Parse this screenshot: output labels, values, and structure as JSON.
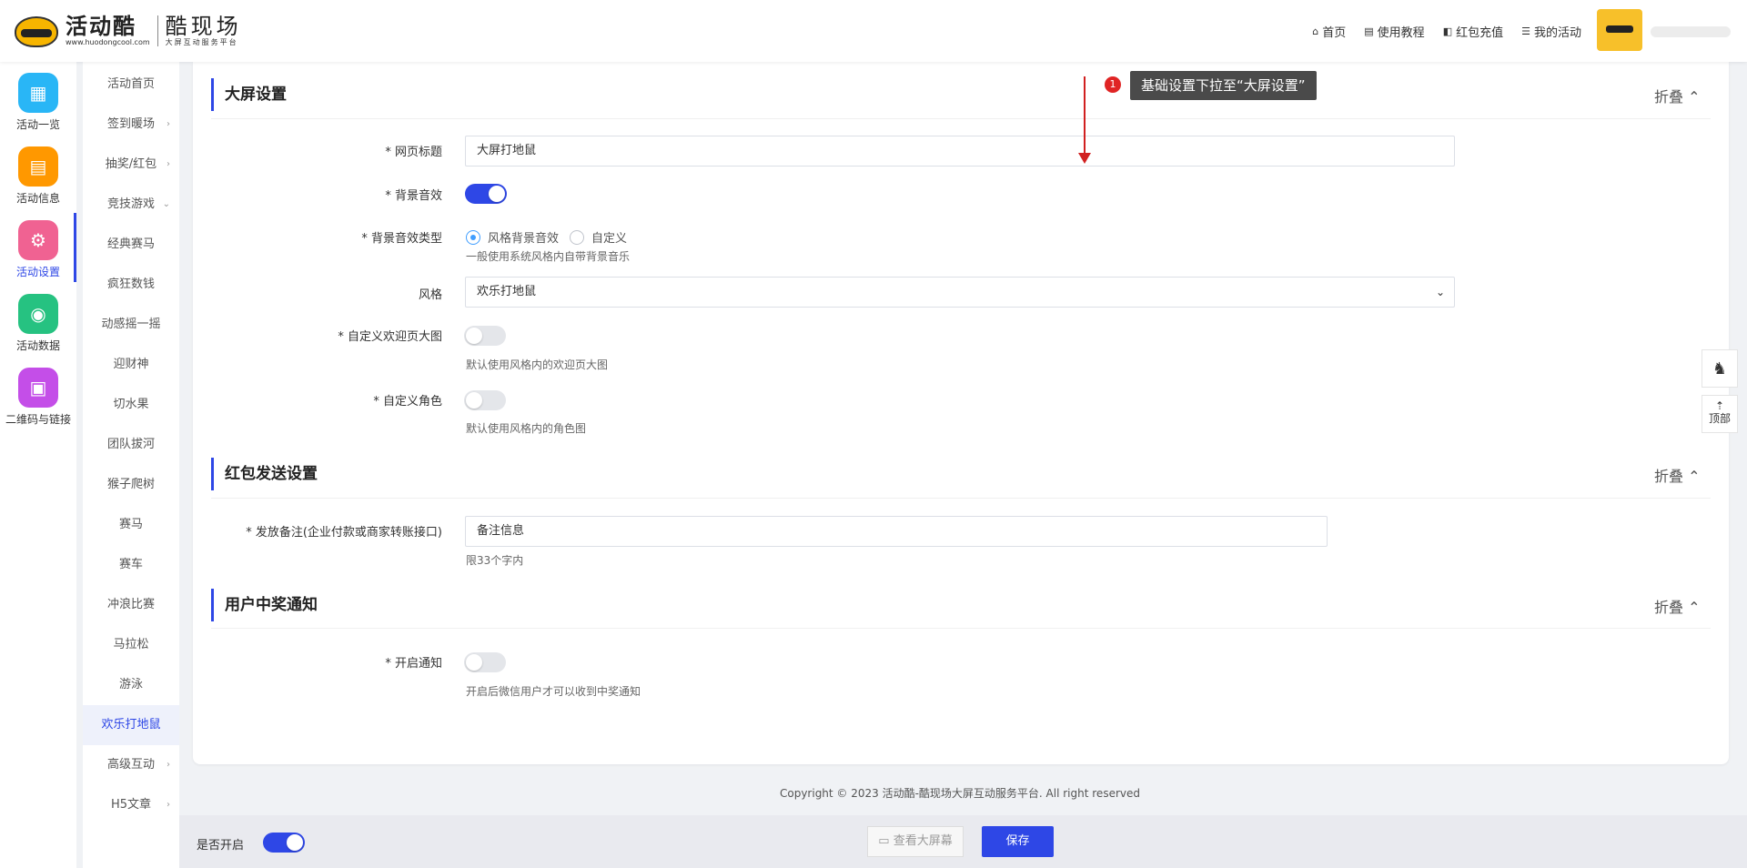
{
  "header": {
    "logo_main": "活动酷",
    "logo_url": "www.huodongcool.com",
    "logo_sub_main": "酷现场",
    "logo_sub_small": "大屏互动服务平台",
    "nav": [
      {
        "icon": "home-icon",
        "glyph": "⌂",
        "label": "首页"
      },
      {
        "icon": "document-icon",
        "glyph": "▤",
        "label": "使用教程"
      },
      {
        "icon": "redpacket-icon",
        "glyph": "◧",
        "label": "红包充值"
      },
      {
        "icon": "list-icon",
        "glyph": "☰",
        "label": "我的活动"
      }
    ]
  },
  "icon_sidebar": [
    {
      "label": "活动一览",
      "icon": "grid-icon",
      "color": "#29b6f6",
      "glyph": "▦"
    },
    {
      "label": "活动信息",
      "icon": "file-icon",
      "color": "#ff9800",
      "glyph": "▤"
    },
    {
      "label": "活动设置",
      "icon": "gear-icon",
      "color": "#f06292",
      "glyph": "⚙",
      "active": true
    },
    {
      "label": "活动数据",
      "icon": "database-icon",
      "color": "#26c281",
      "glyph": "◉"
    },
    {
      "label": "二维码与链接",
      "icon": "qrcode-icon",
      "color": "#c44ee8",
      "glyph": "▣"
    }
  ],
  "sub_sidebar": [
    {
      "label": "活动首页",
      "arrow": ""
    },
    {
      "label": "签到暖场",
      "arrow": "›"
    },
    {
      "label": "抽奖/红包",
      "arrow": "›"
    },
    {
      "label": "竞技游戏",
      "arrow": "⌄"
    },
    {
      "label": "经典赛马",
      "arrow": ""
    },
    {
      "label": "疯狂数钱",
      "arrow": ""
    },
    {
      "label": "动感摇一摇",
      "arrow": ""
    },
    {
      "label": "迎财神",
      "arrow": ""
    },
    {
      "label": "切水果",
      "arrow": ""
    },
    {
      "label": "团队拔河",
      "arrow": ""
    },
    {
      "label": "猴子爬树",
      "arrow": ""
    },
    {
      "label": "赛马",
      "arrow": ""
    },
    {
      "label": "赛车",
      "arrow": ""
    },
    {
      "label": "冲浪比赛",
      "arrow": ""
    },
    {
      "label": "马拉松",
      "arrow": ""
    },
    {
      "label": "游泳",
      "arrow": ""
    },
    {
      "label": "欢乐打地鼠",
      "arrow": "",
      "active": true
    },
    {
      "label": "高级互动",
      "arrow": "›"
    },
    {
      "label": "H5文章",
      "arrow": "›"
    }
  ],
  "annotation": {
    "step": "1",
    "text": "基础设置下拉至“大屏设置”"
  },
  "screen_section": {
    "title": "大屏设置",
    "collapse_label": "折叠 ⌃",
    "page_title_label": "* 网页标题",
    "page_title_value": "大屏打地鼠",
    "bg_sound_label": "* 背景音效",
    "bg_sound_on": true,
    "bg_sound_type_label": "* 背景音效类型",
    "bg_sound_type_options": [
      "风格背景音效",
      "自定义"
    ],
    "bg_sound_type_hint": "一般使用系统风格内自带背景音乐",
    "style_label": "风格",
    "style_value": "欢乐打地鼠",
    "custom_welcome_label": "* 自定义欢迎页大图",
    "custom_welcome_on": false,
    "custom_welcome_hint": "默认使用风格内的欢迎页大图",
    "custom_role_label": "* 自定义角色",
    "custom_role_on": false,
    "custom_role_hint": "默认使用风格内的角色图"
  },
  "redpacket_section": {
    "title": "红包发送设置",
    "collapse_label": "折叠 ⌃",
    "remark_label": "* 发放备注(企业付款或商家转账接口)",
    "remark_value": "备注信息",
    "remark_hint": "限33个字内"
  },
  "notify_section": {
    "title": "用户中奖通知",
    "collapse_label": "折叠 ⌃",
    "notify_label": "* 开启通知",
    "notify_on": false,
    "notify_hint": "开启后微信用户才可以收到中奖通知"
  },
  "float": {
    "qq_glyph": "♞",
    "top_glyph": "⇡",
    "top_label": "顶部"
  },
  "footer": {
    "copyright": "Copyright © 2023 活动酷-酷现场大屏互动服务平台. All right reserved"
  },
  "bottom_bar": {
    "enable_label": "是否开启",
    "enabled": true,
    "view_label": "▭ 查看大屏幕",
    "save_label": "保存"
  },
  "colors": {
    "accent": "#2e47e6",
    "annotation_red": "#d12020"
  }
}
